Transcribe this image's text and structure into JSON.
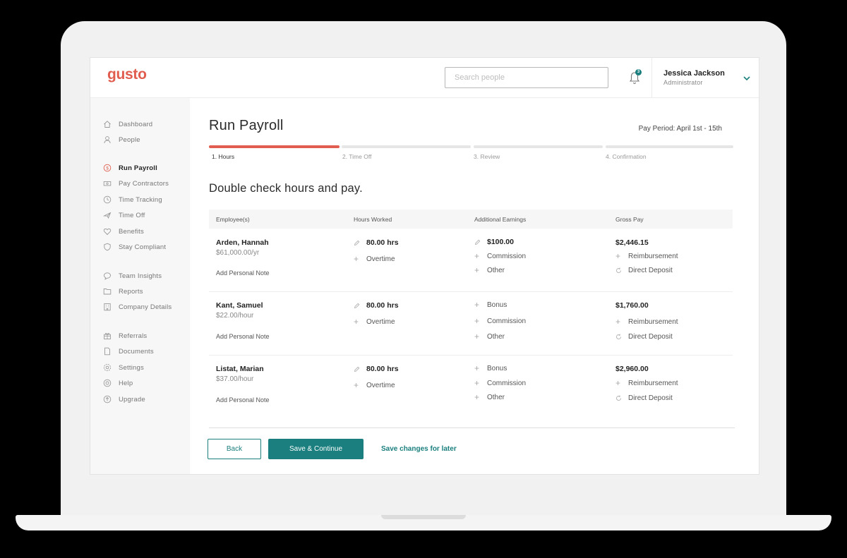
{
  "app": {
    "logo": "gusto"
  },
  "search": {
    "placeholder": "Search people"
  },
  "notifications": {
    "count": "3"
  },
  "user": {
    "name": "Jessica Jackson",
    "role": "Administrator"
  },
  "sidebar": {
    "items": [
      {
        "label": "Dashboard",
        "icon": "home-icon"
      },
      {
        "label": "People",
        "icon": "person-icon"
      },
      {
        "label": "Run Payroll",
        "icon": "dollar-icon",
        "active": true
      },
      {
        "label": "Pay Contractors",
        "icon": "money-icon"
      },
      {
        "label": "Time Tracking",
        "icon": "clock-icon"
      },
      {
        "label": "Time Off",
        "icon": "plane-icon"
      },
      {
        "label": "Benefits",
        "icon": "heart-icon"
      },
      {
        "label": "Stay Compliant",
        "icon": "shield-icon"
      },
      {
        "label": "Team Insights",
        "icon": "chat-icon"
      },
      {
        "label": "Reports",
        "icon": "folder-icon"
      },
      {
        "label": "Company Details",
        "icon": "building-icon"
      },
      {
        "label": "Referrals",
        "icon": "gift-icon"
      },
      {
        "label": "Documents",
        "icon": "document-icon"
      },
      {
        "label": "Settings",
        "icon": "gear-icon"
      },
      {
        "label": "Help",
        "icon": "help-icon"
      },
      {
        "label": "Upgrade",
        "icon": "upgrade-icon"
      }
    ]
  },
  "page": {
    "title": "Run Payroll",
    "pay_period": "Pay Period: April 1st - 15th",
    "section_title": "Double check hours and pay."
  },
  "steps": [
    {
      "label": "1. Hours",
      "active": true
    },
    {
      "label": "2. Time Off",
      "active": false
    },
    {
      "label": "3. Review",
      "active": false
    },
    {
      "label": "4. Confirmation",
      "active": false
    }
  ],
  "table": {
    "headers": [
      "Employee(s)",
      "Hours Worked",
      "Additional Earnings",
      "Gross Pay"
    ],
    "rows": [
      {
        "name": "Arden, Hannah",
        "rate": "$61,000.00/yr",
        "note": "Add Personal Note",
        "hours": "80.00 hrs",
        "overtime": "Overtime",
        "earnings": [
          "$100.00",
          "Commission",
          "Other"
        ],
        "gross": "$2,446.15",
        "reimbursement": "Reimbursement",
        "deposit": "Direct Deposit"
      },
      {
        "name": "Kant, Samuel",
        "rate": "$22.00/hour",
        "note": "Add Personal Note",
        "hours": "80.00 hrs",
        "overtime": "Overtime",
        "earnings": [
          "Bonus",
          "Commission",
          "Other"
        ],
        "gross": "$1,760.00",
        "reimbursement": "Reimbursement",
        "deposit": "Direct Deposit"
      },
      {
        "name": "Listat, Marian",
        "rate": "$37.00/hour",
        "note": "Add Personal Note",
        "hours": "80.00 hrs",
        "overtime": "Overtime",
        "earnings": [
          "Bonus",
          "Commission",
          "Other"
        ],
        "gross": "$2,960.00",
        "reimbursement": "Reimbursement",
        "deposit": "Direct Deposit"
      }
    ]
  },
  "footer": {
    "back_label": "Back",
    "save_label": "Save & Continue",
    "later_label": "Save changes for later"
  },
  "colors": {
    "brand": "#e05d4f",
    "accent": "#1a7f7e"
  }
}
